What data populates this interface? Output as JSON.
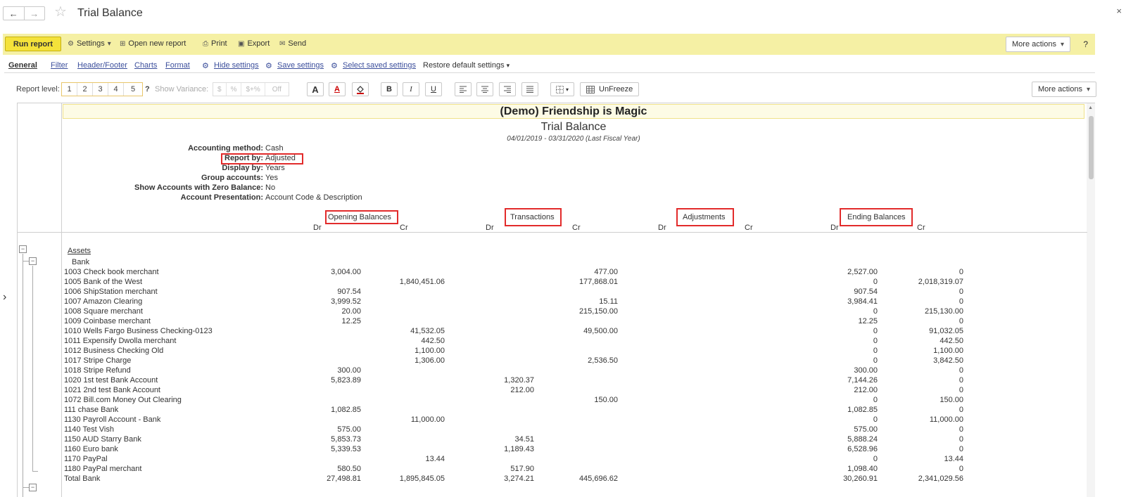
{
  "window": {
    "title": "Trial Balance",
    "back_glyph": "←",
    "forward_glyph": "→",
    "star_glyph": "☆",
    "close_glyph": "×"
  },
  "toolbar": {
    "run_report": "Run report",
    "settings": "Settings",
    "open_new_report": "Open new report",
    "print": "Print",
    "export": "Export",
    "send": "Send",
    "more_actions": "More actions",
    "help": "?",
    "dropdown_glyph": "▾"
  },
  "tabs": {
    "general": "General",
    "filter": "Filter",
    "header_footer": "Header/Footer",
    "charts": "Charts",
    "format": "Format",
    "hide_settings": "Hide settings",
    "save_settings": "Save settings",
    "select_saved_settings": "Select saved settings",
    "restore_default_settings": "Restore default settings"
  },
  "format_bar": {
    "report_level_label": "Report level:",
    "levels": [
      "1",
      "2",
      "3",
      "4",
      "5"
    ],
    "level_help": "?",
    "show_variance_label": "Show Variance:",
    "variance_options": [
      "$",
      "%",
      "$+%",
      "Off"
    ],
    "font_color_glyph": "A",
    "font_underline_color_glyph": "A",
    "bold_glyph": "B",
    "italic_glyph": "I",
    "underline_glyph": "U",
    "unfreeze": "UnFreeze",
    "more_actions": "More actions"
  },
  "report": {
    "company": "(Demo) Friendship is Magic",
    "title": "Trial Balance",
    "period": "04/01/2019 - 03/31/2020 (Last Fiscal Year)",
    "params": [
      {
        "label": "Accounting method:",
        "value": "Cash"
      },
      {
        "label": "Report by:",
        "value": "Adjusted"
      },
      {
        "label": "Display by:",
        "value": "Years"
      },
      {
        "label": "Group accounts:",
        "value": "Yes"
      },
      {
        "label": "Show Accounts with Zero Balance:",
        "value": "No"
      },
      {
        "label": "Account Presentation:",
        "value": "Account Code & Description"
      }
    ],
    "column_groups": [
      "Opening Balances",
      "Transactions",
      "Adjustments",
      "Ending Balances"
    ],
    "dr": "Dr",
    "cr": "Cr",
    "section": "Assets",
    "subsection": "Bank",
    "tree_collapse_glyph": "−",
    "side_arrow": "›",
    "rows": [
      {
        "account": "1003 Check book merchant",
        "open_dr": "3,004.00",
        "open_cr": "",
        "trans_dr": "",
        "trans_cr": "477.00",
        "end_dr": "2,527.00",
        "end_cr": "0"
      },
      {
        "account": "1005 Bank of the West",
        "open_dr": "",
        "open_cr": "1,840,451.06",
        "trans_dr": "",
        "trans_cr": "177,868.01",
        "end_dr": "0",
        "end_cr": "2,018,319.07"
      },
      {
        "account": "1006 ShipStation merchant",
        "open_dr": "907.54",
        "open_cr": "",
        "trans_dr": "",
        "trans_cr": "",
        "end_dr": "907.54",
        "end_cr": "0"
      },
      {
        "account": "1007 Amazon Clearing",
        "open_dr": "3,999.52",
        "open_cr": "",
        "trans_dr": "",
        "trans_cr": "15.11",
        "end_dr": "3,984.41",
        "end_cr": "0"
      },
      {
        "account": "1008 Square merchant",
        "open_dr": "20.00",
        "open_cr": "",
        "trans_dr": "",
        "trans_cr": "215,150.00",
        "end_dr": "0",
        "end_cr": "215,130.00"
      },
      {
        "account": "1009 Coinbase merchant",
        "open_dr": "12.25",
        "open_cr": "",
        "trans_dr": "",
        "trans_cr": "",
        "end_dr": "12.25",
        "end_cr": "0"
      },
      {
        "account": "1010 Wells Fargo Business Checking-0123",
        "open_dr": "",
        "open_cr": "41,532.05",
        "trans_dr": "",
        "trans_cr": "49,500.00",
        "end_dr": "0",
        "end_cr": "91,032.05"
      },
      {
        "account": "1011 Expensify Dwolla merchant",
        "open_dr": "",
        "open_cr": "442.50",
        "trans_dr": "",
        "trans_cr": "",
        "end_dr": "0",
        "end_cr": "442.50"
      },
      {
        "account": "1012 Business Checking Old",
        "open_dr": "",
        "open_cr": "1,100.00",
        "trans_dr": "",
        "trans_cr": "",
        "end_dr": "0",
        "end_cr": "1,100.00"
      },
      {
        "account": "1017 Stripe Charge",
        "open_dr": "",
        "open_cr": "1,306.00",
        "trans_dr": "",
        "trans_cr": "2,536.50",
        "end_dr": "0",
        "end_cr": "3,842.50"
      },
      {
        "account": "1018 Stripe Refund",
        "open_dr": "300.00",
        "open_cr": "",
        "trans_dr": "",
        "trans_cr": "",
        "end_dr": "300.00",
        "end_cr": "0"
      },
      {
        "account": "1020 1st test Bank Account",
        "open_dr": "5,823.89",
        "open_cr": "",
        "trans_dr": "1,320.37",
        "trans_cr": "",
        "end_dr": "7,144.26",
        "end_cr": "0"
      },
      {
        "account": "1021 2nd test Bank Account",
        "open_dr": "",
        "open_cr": "",
        "trans_dr": "212.00",
        "trans_cr": "",
        "end_dr": "212.00",
        "end_cr": "0"
      },
      {
        "account": "1072 Bill.com Money Out Clearing",
        "open_dr": "",
        "open_cr": "",
        "trans_dr": "",
        "trans_cr": "150.00",
        "end_dr": "0",
        "end_cr": "150.00"
      },
      {
        "account": "111 chase Bank",
        "open_dr": "1,082.85",
        "open_cr": "",
        "trans_dr": "",
        "trans_cr": "",
        "end_dr": "1,082.85",
        "end_cr": "0"
      },
      {
        "account": "1130 Payroll Account - Bank",
        "open_dr": "",
        "open_cr": "11,000.00",
        "trans_dr": "",
        "trans_cr": "",
        "end_dr": "0",
        "end_cr": "11,000.00"
      },
      {
        "account": "1140 Test Vish",
        "open_dr": "575.00",
        "open_cr": "",
        "trans_dr": "",
        "trans_cr": "",
        "end_dr": "575.00",
        "end_cr": "0"
      },
      {
        "account": "1150 AUD Starry Bank",
        "open_dr": "5,853.73",
        "open_cr": "",
        "trans_dr": "34.51",
        "trans_cr": "",
        "end_dr": "5,888.24",
        "end_cr": "0"
      },
      {
        "account": "1160 Euro bank",
        "open_dr": "5,339.53",
        "open_cr": "",
        "trans_dr": "1,189.43",
        "trans_cr": "",
        "end_dr": "6,528.96",
        "end_cr": "0"
      },
      {
        "account": "1170 PayPal",
        "open_dr": "",
        "open_cr": "13.44",
        "trans_dr": "",
        "trans_cr": "",
        "end_dr": "0",
        "end_cr": "13.44"
      },
      {
        "account": "1180 PayPal merchant",
        "open_dr": "580.50",
        "open_cr": "",
        "trans_dr": "517.90",
        "trans_cr": "",
        "end_dr": "1,098.40",
        "end_cr": "0"
      },
      {
        "account": "Total Bank",
        "open_dr": "27,498.81",
        "open_cr": "1,895,845.05",
        "trans_dr": "3,274.21",
        "trans_cr": "445,696.62",
        "end_dr": "30,260.91",
        "end_cr": "2,341,029.56"
      }
    ]
  }
}
